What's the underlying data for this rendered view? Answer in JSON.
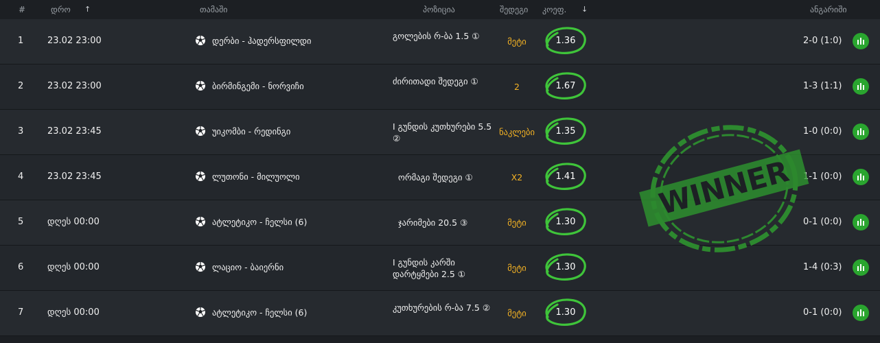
{
  "header": {
    "num": "#",
    "time": "დრო",
    "time_sort": "↑",
    "match": "თამაში",
    "position": "პოზიცია",
    "outcome": "შედეგი",
    "odds": "კოეფ.",
    "odds_sort": "↓",
    "score": "ანგარიში"
  },
  "rows": [
    {
      "num": "1",
      "date": "23.02  23:00",
      "match": "დერბი - ჰადერსფილდი",
      "position": "გოლების რ-ბა 1.5 ①",
      "outcome": "მეტი",
      "odds": "1.36",
      "score": "2-0 (1:0)"
    },
    {
      "num": "2",
      "date": "23.02  23:00",
      "match": "ბირმინგემი - ნორვიჩი",
      "position": "ძირითადი შედეგი ①",
      "outcome": "2",
      "odds": "1.67",
      "score": "1-3 (1:1)"
    },
    {
      "num": "3",
      "date": "23.02  23:45",
      "match": "უიკომბი - რედინგი",
      "position": "I გუნდის კუთხურები 5.5 ②",
      "outcome": "ნაკლები",
      "odds": "1.35",
      "score": "1-0 (0:0)"
    },
    {
      "num": "4",
      "date": "23.02  23:45",
      "match": "ლუთონი - მილუოლი",
      "position": "ორმაგი შედეგი ①",
      "outcome": "X2",
      "odds": "1.41",
      "score": "1-1 (0:0)"
    },
    {
      "num": "5",
      "date": "დღეს  00:00",
      "match": "ატლეტიკო - ჩელსი (6)",
      "position": "ჯარიმები 20.5 ③",
      "outcome": "მეტი",
      "odds": "1.30",
      "score": "0-1 (0:0)"
    },
    {
      "num": "6",
      "date": "დღეს  00:00",
      "match": "ლაციო - ბაიერნი",
      "position": "I გუნდის კარში დარტყმები 2.5 ①",
      "outcome": "მეტი",
      "odds": "1.30",
      "score": "1-4 (0:3)"
    },
    {
      "num": "7",
      "date": "დღეს  00:00",
      "match": "ატლეტიკო - ჩელსი (6)",
      "position": "კუთხურების რ-ბა 7.5 ②",
      "outcome": "მეტი",
      "odds": "1.30",
      "score": "0-1 (0:0)"
    }
  ],
  "stamp": {
    "text": "WINNER"
  },
  "colors": {
    "accent_green": "#2aa52f",
    "outcome_orange": "#f5b324",
    "circle_green": "#3fc43a"
  },
  "icons": {
    "match": "soccer-ball-icon",
    "stats": "stats-bars-icon"
  }
}
